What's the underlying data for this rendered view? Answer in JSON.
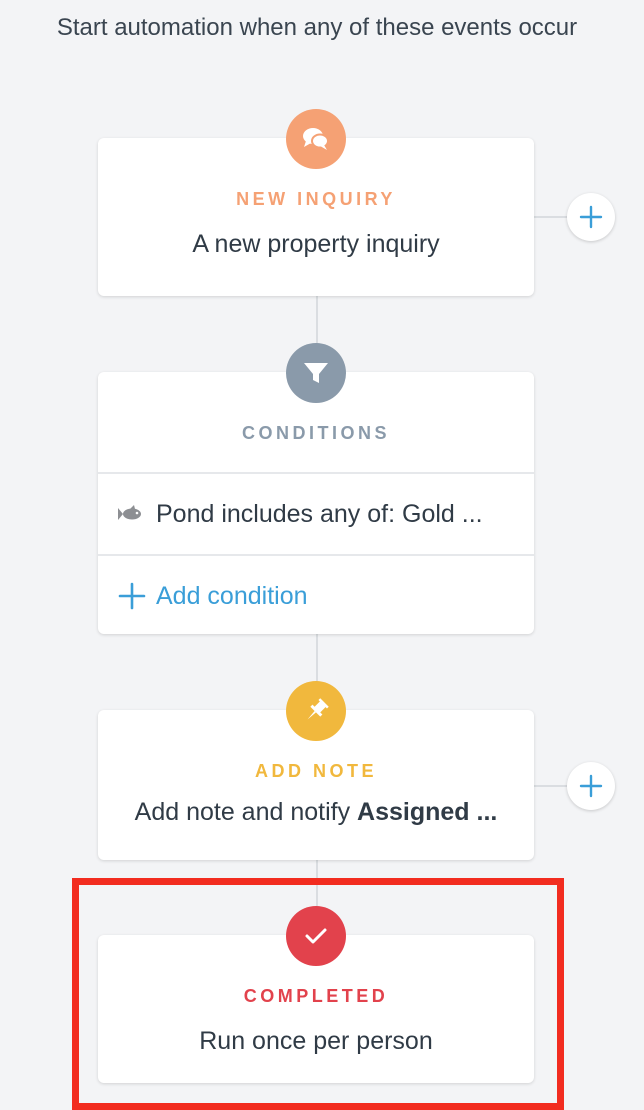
{
  "header": {
    "title": "Start automation when any of these events occur"
  },
  "colors": {
    "trigger": "#f5a174",
    "conditions": "#8a9aaa",
    "note": "#f1b83d",
    "completed": "#e2424c",
    "link": "#3a9ed8",
    "highlight": "#f22c1f"
  },
  "steps": {
    "trigger": {
      "icon": "chat-bubbles-icon",
      "title": "NEW INQUIRY",
      "description": "A new property inquiry"
    },
    "conditions": {
      "icon": "filter-icon",
      "title": "CONDITIONS",
      "items": [
        {
          "icon": "fish-icon",
          "text": "Pond includes any of: Gold ..."
        }
      ],
      "add_label": "Add condition"
    },
    "note": {
      "icon": "pushpin-icon",
      "title": "ADD NOTE",
      "description_prefix": "Add note and notify ",
      "description_bold": "Assigned ..."
    },
    "completed": {
      "icon": "checkmark-icon",
      "title": "COMPLETED",
      "description": "Run once per person"
    }
  }
}
